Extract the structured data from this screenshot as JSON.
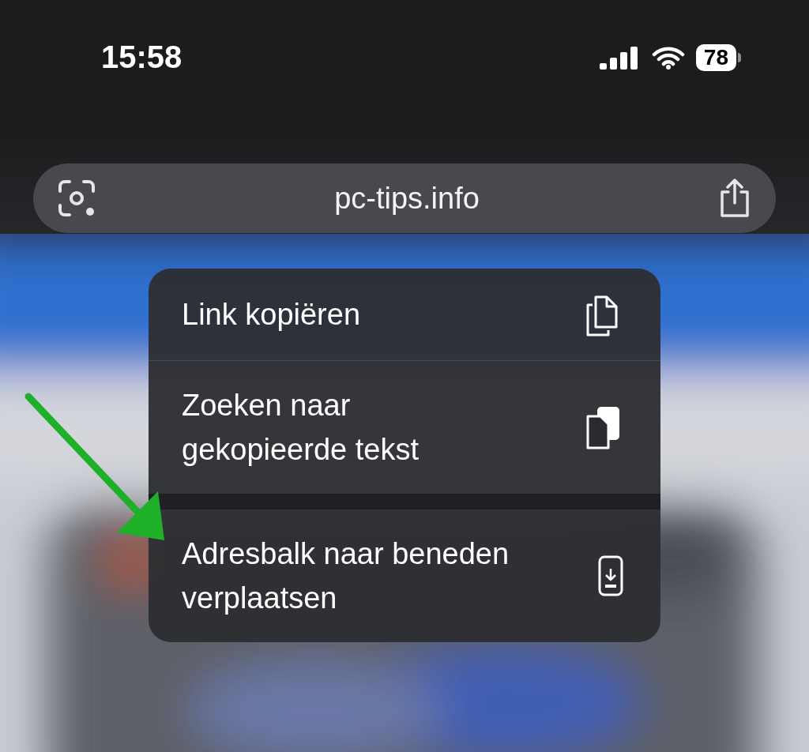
{
  "status_bar": {
    "time": "15:58",
    "battery": "78"
  },
  "address_bar": {
    "url": "pc-tips.info"
  },
  "menu": {
    "items": [
      {
        "label": "Link kopiëren",
        "kind": "copy",
        "new_group": false
      },
      {
        "label": "Zoeken naar\ngekopieerde tekst",
        "kind": "search-copied",
        "new_group": false
      },
      {
        "label": "Adresbalk naar beneden\nverplaatsen",
        "kind": "move-bar",
        "new_group": true
      }
    ]
  }
}
